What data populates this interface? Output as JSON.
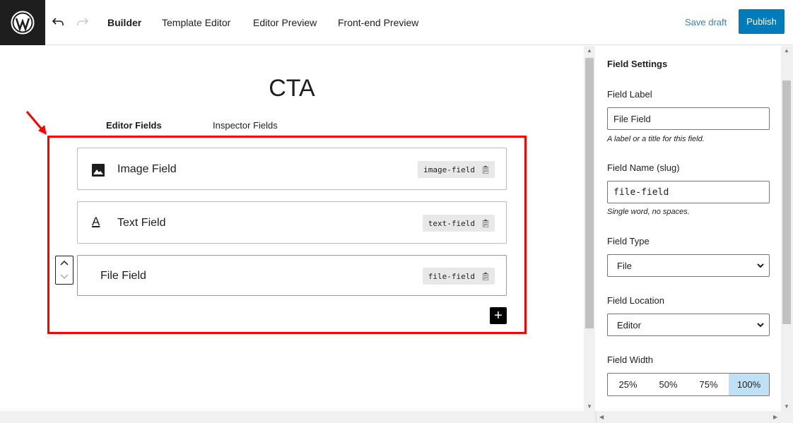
{
  "header": {
    "nav": [
      "Builder",
      "Template Editor",
      "Editor Preview",
      "Front-end Preview"
    ],
    "save_draft": "Save draft",
    "publish": "Publish"
  },
  "main": {
    "title": "CTA",
    "tabs": [
      "Editor Fields",
      "Inspector Fields"
    ],
    "fields": [
      {
        "label": "Image Field",
        "slug": "image-field",
        "icon": "image-icon"
      },
      {
        "label": "Text Field",
        "slug": "text-field",
        "icon": "text-icon"
      },
      {
        "label": "File Field",
        "slug": "file-field",
        "icon": "none"
      }
    ],
    "add": "+"
  },
  "settings": {
    "heading": "Field Settings",
    "label_label": "Field Label",
    "label_value": "File Field",
    "label_help": "A label or a title for this field.",
    "name_label": "Field Name (slug)",
    "name_value": "file-field",
    "name_help": "Single word, no spaces.",
    "type_label": "Field Type",
    "type_value": "File",
    "location_label": "Field Location",
    "location_value": "Editor",
    "width_label": "Field Width",
    "widths": [
      "25%",
      "50%",
      "75%",
      "100%"
    ],
    "selected_width": "100%"
  },
  "colors": {
    "accent": "#007cba",
    "highlight": "#ff0000",
    "selected": "#bfe1f7"
  }
}
